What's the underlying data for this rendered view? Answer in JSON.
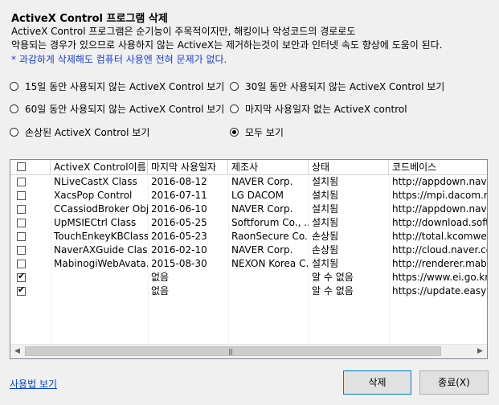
{
  "title": "ActiveX Control 프로그램 삭제",
  "description_line1": "ActiveX Control 프로그램은 순기능이 주목적이지만, 해킹이나 악성코드의 경로로도",
  "description_line2": "악용되는 경우가 있으므로 사용하지 않는 ActiveX는 제거하는것이 보안과 인터넷 속도 향상에 도움이 된다.",
  "note": "* 과감하게 삭제해도 컴퓨터 사용엔 전혀 문제가 없다.",
  "filters": {
    "unused15": {
      "label": "15일 동안 사용되지 않는 ActiveX Control 보기",
      "selected": false
    },
    "unused30": {
      "label": "30일 동안 사용되지 않는 ActiveX Control 보기",
      "selected": false
    },
    "unused60": {
      "label": "60일 동안 사용되지 않는 ActiveX Control 보기",
      "selected": false
    },
    "no_last_user": {
      "label": "마지막 사용일자 없는 ActiveX control",
      "selected": false
    },
    "damaged": {
      "label": "손상된 ActiveX Control 보기",
      "selected": false
    },
    "all": {
      "label": "모두 보기",
      "selected": true
    }
  },
  "table": {
    "columns": [
      "",
      "ActiveX Control이름",
      "마지막 사용일자",
      "제조사",
      "상태",
      "코드베이스"
    ],
    "rows": [
      {
        "checked": false,
        "name": "NLiveCastX Class",
        "last_used": "2016-08-12",
        "vendor": "NAVER Corp.",
        "status": "설치됨",
        "codebase": "http://appdown.naver.c"
      },
      {
        "checked": false,
        "name": "XacsPop Control",
        "last_used": "2016-07-11",
        "vendor": "LG DACOM",
        "status": "설치됨",
        "codebase": "https://mpi.dacom.net/X"
      },
      {
        "checked": false,
        "name": "CCassiodBroker Obj...",
        "last_used": "2016-06-10",
        "vendor": "NAVER Corp.",
        "status": "설치됨",
        "codebase": "http://appdown.naver.c"
      },
      {
        "checked": false,
        "name": "UpMSIECtrl Class",
        "last_used": "2016-05-25",
        "vendor": "Softforum Co., ...",
        "status": "설치됨",
        "codebase": "http://download.softfor"
      },
      {
        "checked": false,
        "name": "TouchEnkeyKBClass",
        "last_used": "2016-05-23",
        "vendor": "RaonSecure Co....",
        "status": "손상됨",
        "codebase": "http://total.kcomwel.or.k"
      },
      {
        "checked": false,
        "name": "NaverAXGuide Class",
        "last_used": "2016-02-10",
        "vendor": "NAVER Corp.",
        "status": "손상됨",
        "codebase": "http://cloud.naver.com/a"
      },
      {
        "checked": false,
        "name": "MabinogiWebAvata...",
        "last_used": "2015-08-30",
        "vendor": "NEXON Korea C...",
        "status": "설치됨",
        "codebase": "http://renderer.mabinog"
      },
      {
        "checked": true,
        "name": "",
        "last_used": "없음",
        "vendor": "",
        "status": "알 수 없음",
        "codebase": "https://www.ei.go.kr/ei/"
      },
      {
        "checked": true,
        "name": "",
        "last_used": "없음",
        "vendor": "",
        "status": "알 수 없음",
        "codebase": "https://update.easykeyt"
      }
    ]
  },
  "scroll": {
    "left_arrow": "◀",
    "right_arrow": "▶",
    "grip": "|||"
  },
  "footer": {
    "usage_link": "사용법 보기",
    "delete_label": "삭제",
    "close_label": "종료(X)"
  }
}
